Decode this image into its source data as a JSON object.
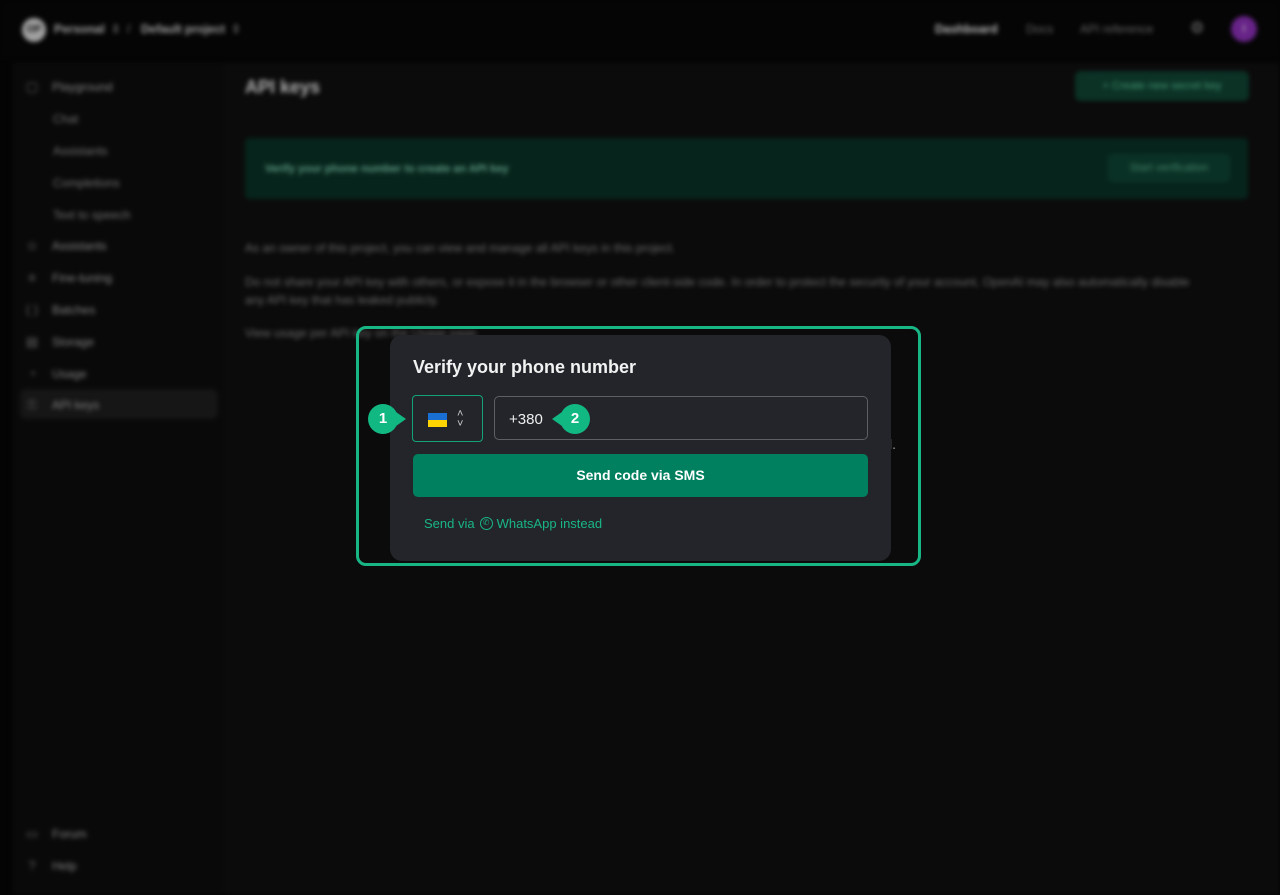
{
  "topbar": {
    "logo": "OP",
    "org": "Personal",
    "project": "Default project",
    "nav": [
      "Dashboard",
      "Docs",
      "API reference"
    ],
    "avatar_initial": "I"
  },
  "sidebar": {
    "items": [
      {
        "label": "Playground",
        "icon": "playground-icon"
      },
      {
        "label": "Chat"
      },
      {
        "label": "Assistants"
      },
      {
        "label": "Completions"
      },
      {
        "label": "Text to speech"
      },
      {
        "label": "Assistants",
        "icon": "assistants-icon"
      },
      {
        "label": "Fine-tuning",
        "icon": "fine-tuning-icon"
      },
      {
        "label": "Batches",
        "icon": "batches-icon"
      },
      {
        "label": "Storage",
        "icon": "storage-icon"
      },
      {
        "label": "Usage",
        "icon": "usage-icon"
      },
      {
        "label": "API keys",
        "icon": "key-icon"
      }
    ],
    "footer": [
      {
        "label": "Forum",
        "icon": "forum-icon"
      },
      {
        "label": "Help",
        "icon": "help-icon"
      }
    ]
  },
  "main": {
    "title": "API keys",
    "create_button": "+ Create new secret key",
    "banner_text": "Verify your phone number to create an API key",
    "banner_button": "Start verification",
    "para1": "As an owner of this project, you can view and manage all API keys in this project.",
    "para2": "Do not share your API key with others, or expose it in the browser or other client-side code. In order to protect the security of your account, OpenAI may also automatically disable any API key that has leaked publicly.",
    "para3": "View usage per API key on the Usage page.",
    "ghost_char": "l."
  },
  "modal": {
    "title": "Verify your phone number",
    "country_flag": "ukraine-flag",
    "phone_value": "+380",
    "send_sms": "Send code via SMS",
    "whatsapp_prefix": "Send via",
    "whatsapp_label": "WhatsApp instead"
  },
  "annotations": {
    "badge1": "1",
    "badge2": "2",
    "accent": "#19b685"
  }
}
